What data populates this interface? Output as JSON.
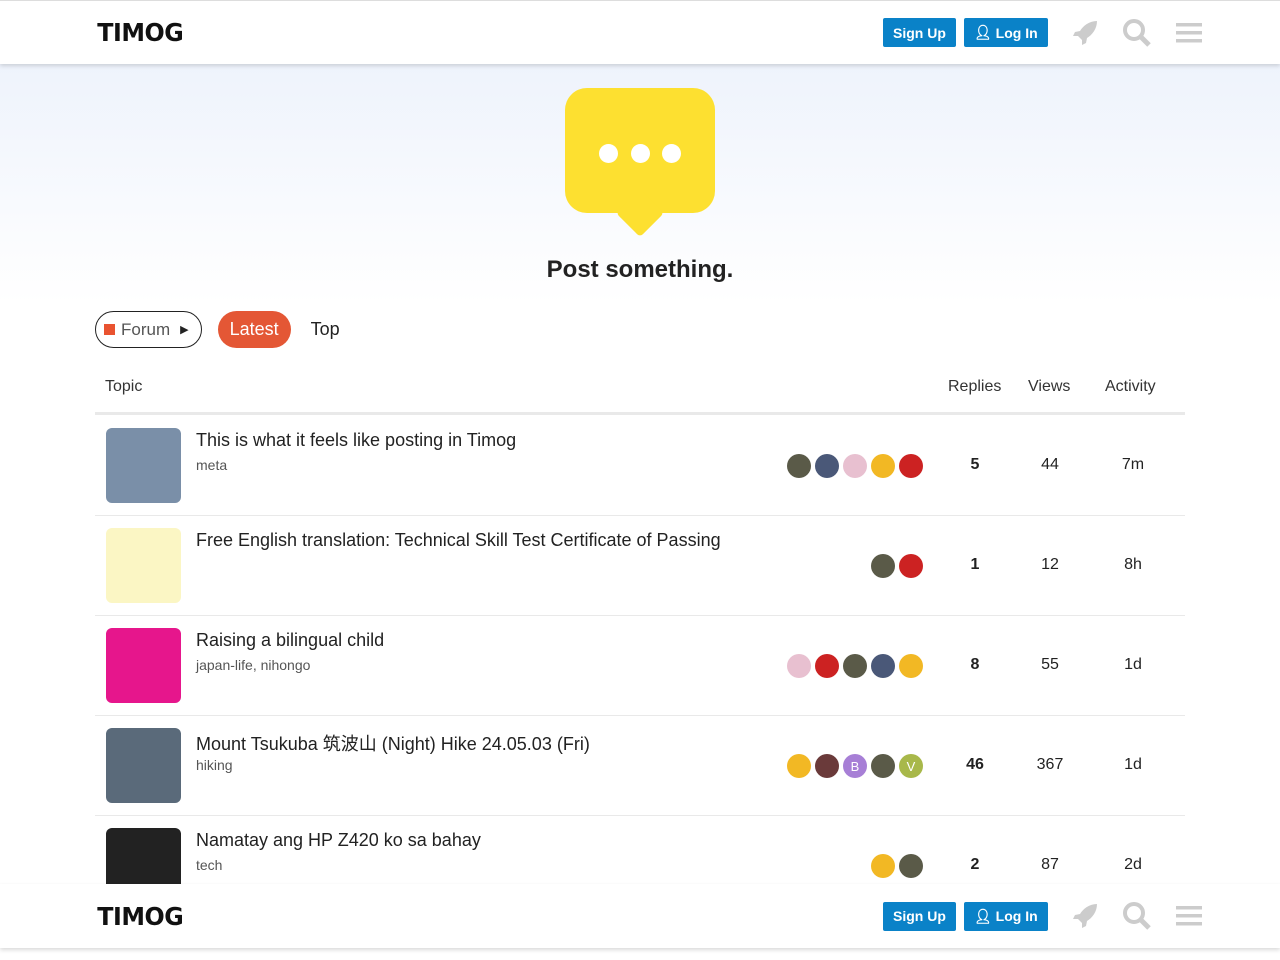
{
  "header": {
    "logo": "TIMOG",
    "signup": "Sign Up",
    "login": "Log In"
  },
  "hero": {
    "title": "Post something."
  },
  "nav": {
    "category": "Forum",
    "latest": "Latest",
    "top": "Top"
  },
  "table": {
    "headers": {
      "topic": "Topic",
      "replies": "Replies",
      "views": "Views",
      "activity": "Activity"
    },
    "rows": [
      {
        "title": "This is what it feels like posting in Timog",
        "tags": "meta",
        "replies": "5",
        "views": "44",
        "activity": "7m",
        "thumb": "#7a8fa8",
        "avatars": [
          "#5a5a48",
          "#4a5878",
          "#e8c0d0",
          "#f2b824",
          "#cc2222"
        ],
        "bold": false
      },
      {
        "title": "Free English translation: Technical Skill Test Certificate of Passing",
        "tags": "",
        "replies": "1",
        "views": "12",
        "activity": "8h",
        "thumb": "#fbf6c4",
        "avatars": [
          "#5a5a48",
          "#cc2222"
        ],
        "bold": false
      },
      {
        "title": "Raising a bilingual child",
        "tags": "japan-life, nihongo",
        "replies": "8",
        "views": "55",
        "activity": "1d",
        "thumb": "#e6168c",
        "avatars": [
          "#e8c0d0",
          "#cc2222",
          "#5a5a48",
          "#4a5878",
          "#f2b824"
        ],
        "bold": false
      },
      {
        "title": "Mount Tsukuba 筑波山 (Night) Hike 24.05.03 (Fri)",
        "tags": "hiking",
        "replies": "46",
        "views": "367",
        "activity": "1d",
        "thumb": "#5a6a7a",
        "avatars": [
          "#f2b824",
          "#6a3a3a",
          "#a77fd6",
          "#5a5a48",
          "#a8b84a"
        ],
        "avatar_letters": [
          "",
          "",
          "B",
          "",
          "V"
        ],
        "bold": true
      },
      {
        "title": "Namatay ang HP Z420 ko sa bahay",
        "tags": "tech",
        "replies": "2",
        "views": "87",
        "activity": "2d",
        "thumb": "#222222",
        "avatars": [
          "#f2b824",
          "#5a5a48"
        ],
        "bold": false
      }
    ]
  }
}
